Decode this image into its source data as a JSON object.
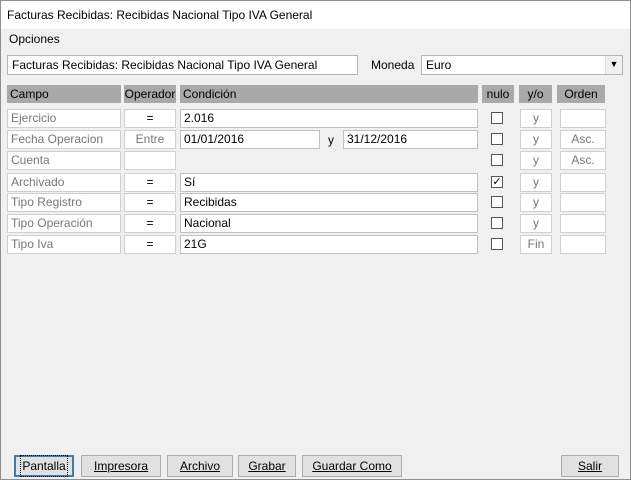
{
  "window": {
    "title": "Facturas Recibidas: Recibidas Nacional Tipo IVA General"
  },
  "menu": {
    "options_label": "Opciones"
  },
  "form": {
    "name_value": "Facturas Recibidas: Recibidas Nacional Tipo IVA General",
    "currency_label": "Moneda",
    "currency_value": "Euro"
  },
  "headers": {
    "campo": "Campo",
    "operador": "Operador",
    "condicion": "Condición",
    "nulo": "nulo",
    "yo": "y/o",
    "orden": "Orden"
  },
  "rows": [
    {
      "campo": "Ejercicio",
      "operador": "=",
      "condicion": "2.016",
      "nulo": false,
      "yo": "y",
      "orden": ""
    },
    {
      "campo": "Fecha Operacion",
      "operador": "Entre",
      "condicion": "01/01/2016",
      "sep": "y",
      "condicion2": "31/12/2016",
      "nulo": false,
      "yo": "y",
      "orden": "Asc."
    },
    {
      "campo": "Cuenta",
      "operador": "",
      "condicion": "",
      "nulo": false,
      "yo": "y",
      "orden": "Asc."
    },
    {
      "campo": "Archivado",
      "operador": "=",
      "condicion": "Sí",
      "nulo": true,
      "yo": "y",
      "orden": ""
    },
    {
      "campo": "Tipo Registro",
      "operador": "=",
      "condicion": "Recibidas",
      "nulo": false,
      "yo": "y",
      "orden": ""
    },
    {
      "campo": "Tipo Operación",
      "operador": "=",
      "condicion": "Nacional",
      "nulo": false,
      "yo": "y",
      "orden": ""
    },
    {
      "campo": "Tipo Iva",
      "operador": "=",
      "condicion": "21G",
      "nulo": false,
      "yo": "Fin",
      "orden": ""
    }
  ],
  "buttons": {
    "pantalla": "Pantalla",
    "impresora": "Impresora",
    "archivo": "Archivo",
    "grabar": "Grabar",
    "guardar_como": "Guardar Como",
    "salir": "Salir"
  }
}
